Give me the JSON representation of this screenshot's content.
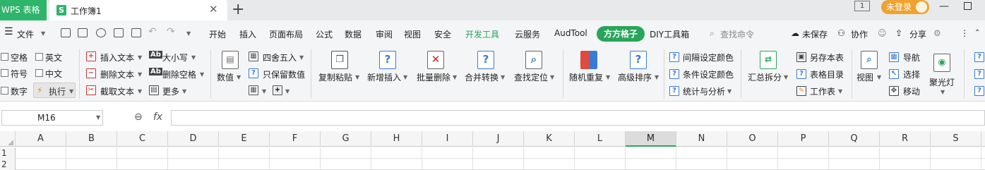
{
  "titlebar": {
    "app_name": "WPS 表格",
    "doc_tab_icon": "S",
    "doc_tab_label": "工作簿1",
    "close_glyph": "✕",
    "new_tab_glyph": "+",
    "window_counter": "1",
    "login_label": "未登录"
  },
  "menubar": {
    "file_label": "文件",
    "tabs": [
      "开始",
      "插入",
      "页面布局",
      "公式",
      "数据",
      "审阅",
      "视图",
      "安全",
      "开发工具",
      "云服务",
      "AudTool",
      "方方格子",
      "DIY工具箱"
    ],
    "search_placeholder": "查找命令",
    "unsaved_label": "未保存",
    "collab_label": "协作",
    "share_label": "分享"
  },
  "ribbon": {
    "checks": [
      "空格",
      "英文",
      "符号",
      "中文",
      "数字"
    ],
    "execute_label": "执行",
    "text_ops": [
      "插入文本",
      "删除文本",
      "截取文本"
    ],
    "case_ops": [
      "大小写",
      "删除空格",
      "更多"
    ],
    "value_label": "数值",
    "round_label": "四舍五入",
    "keep_value_label": "只保留数值",
    "big_buttons": [
      "复制粘贴",
      "新增插入",
      "批量删除",
      "合并转换",
      "查找定位",
      "随机重复",
      "高级排序"
    ],
    "color_ops": [
      "间隔设定颜色",
      "条件设定颜色",
      "统计与分析"
    ],
    "summary_label": "汇总拆分",
    "sheet_ops": [
      "另存本表",
      "表格目录",
      "工作表"
    ],
    "view_label": "视图",
    "nav_ops": [
      "导航",
      "选择",
      "移动"
    ],
    "spotlight_label": "聚光灯"
  },
  "formulabar": {
    "cell_ref": "M16",
    "fx": "fx",
    "formula": ""
  },
  "grid": {
    "columns": [
      "A",
      "B",
      "C",
      "D",
      "E",
      "F",
      "G",
      "H",
      "I",
      "J",
      "K",
      "L",
      "M",
      "N",
      "O",
      "P",
      "Q",
      "R",
      "S"
    ],
    "active_column": "M",
    "rows": [
      "1",
      "2"
    ]
  }
}
